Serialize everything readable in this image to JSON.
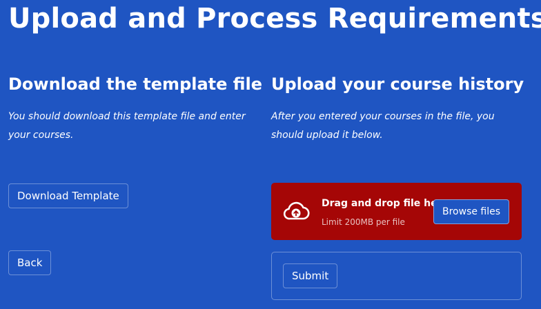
{
  "header": {
    "title": "Upload and Process Requirements"
  },
  "download_section": {
    "title": "Download the template file",
    "description": "You should download this template file and enter your courses.",
    "download_button_label": "Download Template"
  },
  "upload_section": {
    "title": "Upload your course history",
    "description": "After you entered your courses in the file, you should upload it below.",
    "dropzone": {
      "main_text": "Drag and drop file here",
      "limit_text": "Limit 200MB per file",
      "browse_button_label": "Browse files",
      "background_color": "#a50606",
      "icon": "cloud-upload-icon"
    },
    "submit_button_label": "Submit"
  },
  "navigation": {
    "back_button_label": "Back"
  },
  "colors": {
    "page_background": "#1f55c2",
    "text": "#ffffff"
  }
}
